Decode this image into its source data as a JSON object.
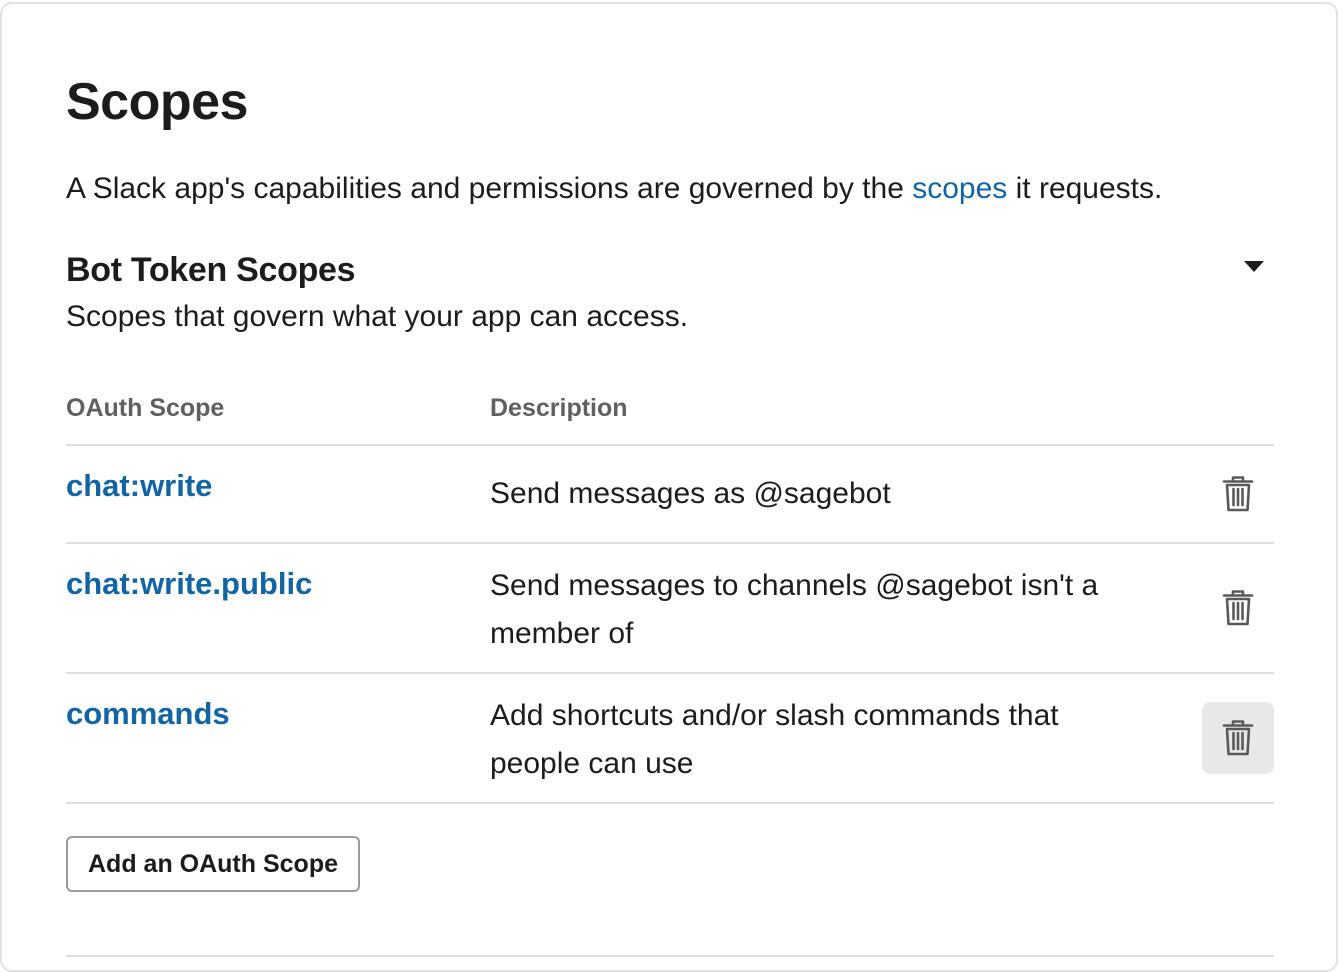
{
  "page": {
    "title": "Scopes",
    "intro_before": "A Slack app's capabilities and permissions are governed by the ",
    "intro_link": "scopes",
    "intro_after": " it requests."
  },
  "bot_token_section": {
    "title": "Bot Token Scopes",
    "subtitle": "Scopes that govern what your app can access.",
    "toggle_icon": "caret-down-icon",
    "columns": {
      "scope": "OAuth Scope",
      "description": "Description"
    },
    "rows": [
      {
        "scope": "chat:write",
        "description": "Send messages as @sagebot",
        "action_icon": "trash-icon"
      },
      {
        "scope": "chat:write.public",
        "description": "Send messages to channels @sagebot isn't a member of",
        "action_icon": "trash-icon"
      },
      {
        "scope": "commands",
        "description": "Add shortcuts and/or slash commands that people can use",
        "action_icon": "trash-icon"
      }
    ],
    "add_button": "Add an OAuth Scope"
  },
  "colors": {
    "link": "#1264a3",
    "text": "#1d1c1d",
    "muted": "#616061",
    "divider": "#dddddd",
    "hover_bg": "#e8e8e8"
  }
}
